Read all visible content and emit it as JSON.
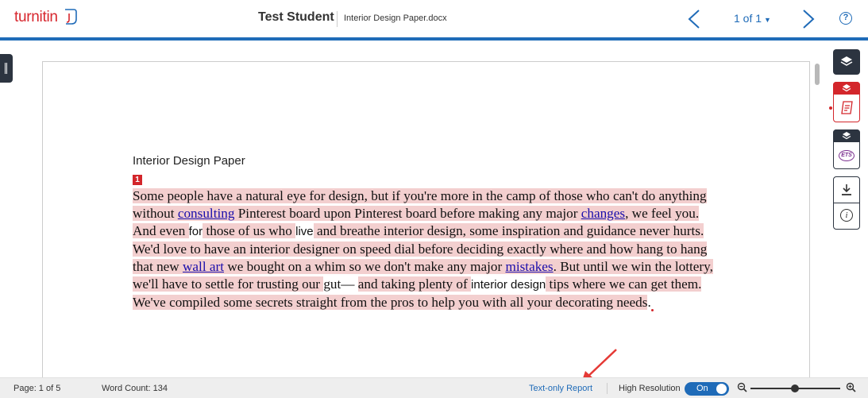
{
  "header": {
    "logo_text": "turnitin",
    "student_name": "Test Student",
    "document_name": "Interior Design Paper.docx",
    "page_indicator": "1 of 1",
    "help_label": "?"
  },
  "document": {
    "title": "Interior Design Paper",
    "match_number": "1",
    "segments": {
      "s1": "Some people have a natural eye for design, but if you're more in the camp of those who can't do anything without ",
      "l1": "consulting",
      "s2": " Pinterest board upon Pinterest board before making any major ",
      "l2": "changes",
      "s3": ", we feel you. And even ",
      "p1": "for",
      "s4": " those of us who ",
      "p2": "live",
      "s5": " and breathe interior design, some inspiration and guidance never hurts. We'd love to have an interior designer on speed dial before deciding exactly where and how hang to hang that new ",
      "l3": "wall art",
      "s6": " we bought on a whim so we don't make any major ",
      "l4": "mistakes",
      "s7": ". But until we win the lottery, we'll have to settle for trusting our ",
      "p3": "gut—",
      "s8": "and taking plenty of ",
      "p4": "interior design",
      "s9": " tips where we can get them. We've compiled some secrets straight from the pros to help you with all your decorating needs",
      "end": "."
    }
  },
  "right_rail": {
    "ets_label": "ETS",
    "info_label": "i"
  },
  "footer": {
    "page_count": "Page: 1 of 5",
    "word_count": "Word Count: 134",
    "text_only_report": "Text-only Report",
    "high_resolution_label": "High Resolution",
    "toggle_state": "On"
  },
  "colors": {
    "brand_red": "#d7262d",
    "accent_blue": "#1f6bb8",
    "match_highlight": "#f3cfcf",
    "dark_rail": "#2c3440"
  }
}
